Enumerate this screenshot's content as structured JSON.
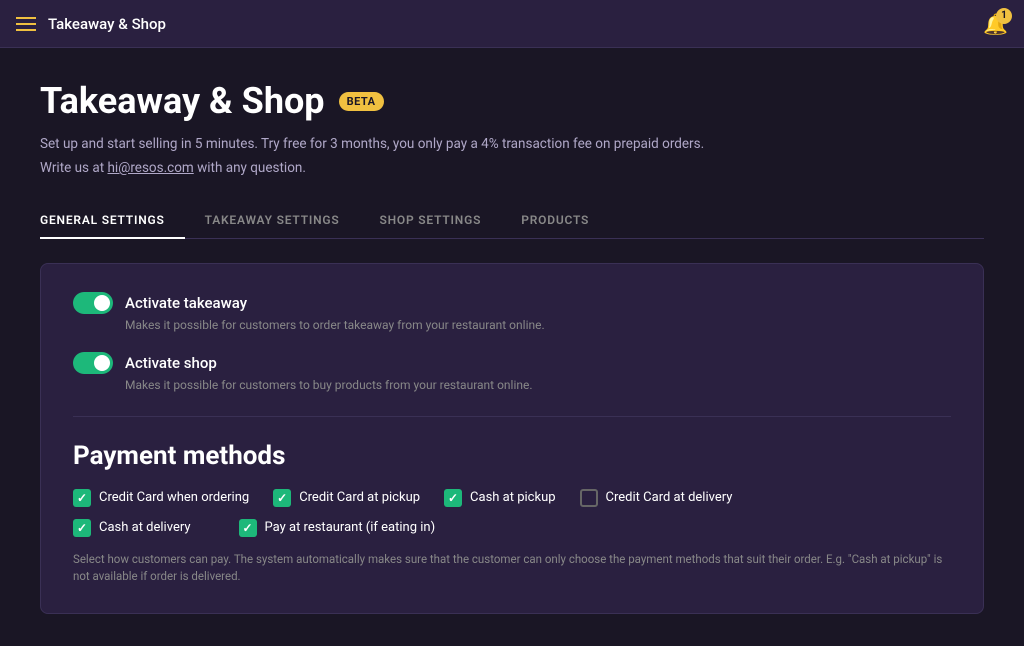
{
  "app": {
    "title": "Takeaway & Shop",
    "notification_count": "1"
  },
  "page": {
    "title": "Takeaway & Shop",
    "beta_label": "BETA",
    "subtitle": "Set up and start selling in 5 minutes. Try free for 3 months, you only pay a 4% transaction fee on prepaid orders.",
    "subtitle2": "Write us at hi@resos.com with any question.",
    "email_link": "hi@resos.com"
  },
  "tabs": [
    {
      "id": "general",
      "label": "GENERAL SETTINGS",
      "active": true
    },
    {
      "id": "takeaway",
      "label": "TAKEAWAY SETTINGS",
      "active": false
    },
    {
      "id": "shop",
      "label": "SHOP SETTINGS",
      "active": false
    },
    {
      "id": "products",
      "label": "PRODUCTS",
      "active": false
    }
  ],
  "toggles": [
    {
      "id": "activate-takeaway",
      "label": "Activate takeaway",
      "description": "Makes it possible for customers to order takeaway from your restaurant online.",
      "enabled": true
    },
    {
      "id": "activate-shop",
      "label": "Activate shop",
      "description": "Makes it possible for customers to buy products from your restaurant online.",
      "enabled": true
    }
  ],
  "payment_methods": {
    "title": "Payment methods",
    "items": [
      {
        "id": "cc-ordering",
        "label": "Credit Card when ordering",
        "checked": true
      },
      {
        "id": "cc-pickup",
        "label": "Credit Card at pickup",
        "checked": true
      },
      {
        "id": "cash-pickup",
        "label": "Cash at pickup",
        "checked": true
      },
      {
        "id": "cc-delivery",
        "label": "Credit Card at delivery",
        "checked": false
      },
      {
        "id": "cash-delivery",
        "label": "Cash at delivery",
        "checked": true
      },
      {
        "id": "pay-restaurant",
        "label": "Pay at restaurant (if eating in)",
        "checked": true
      }
    ],
    "note": "Select how customers can pay. The system automatically makes sure that the customer can only choose the payment methods that suit their order. E.g. \"Cash at pickup\" is not available if order is delivered."
  }
}
